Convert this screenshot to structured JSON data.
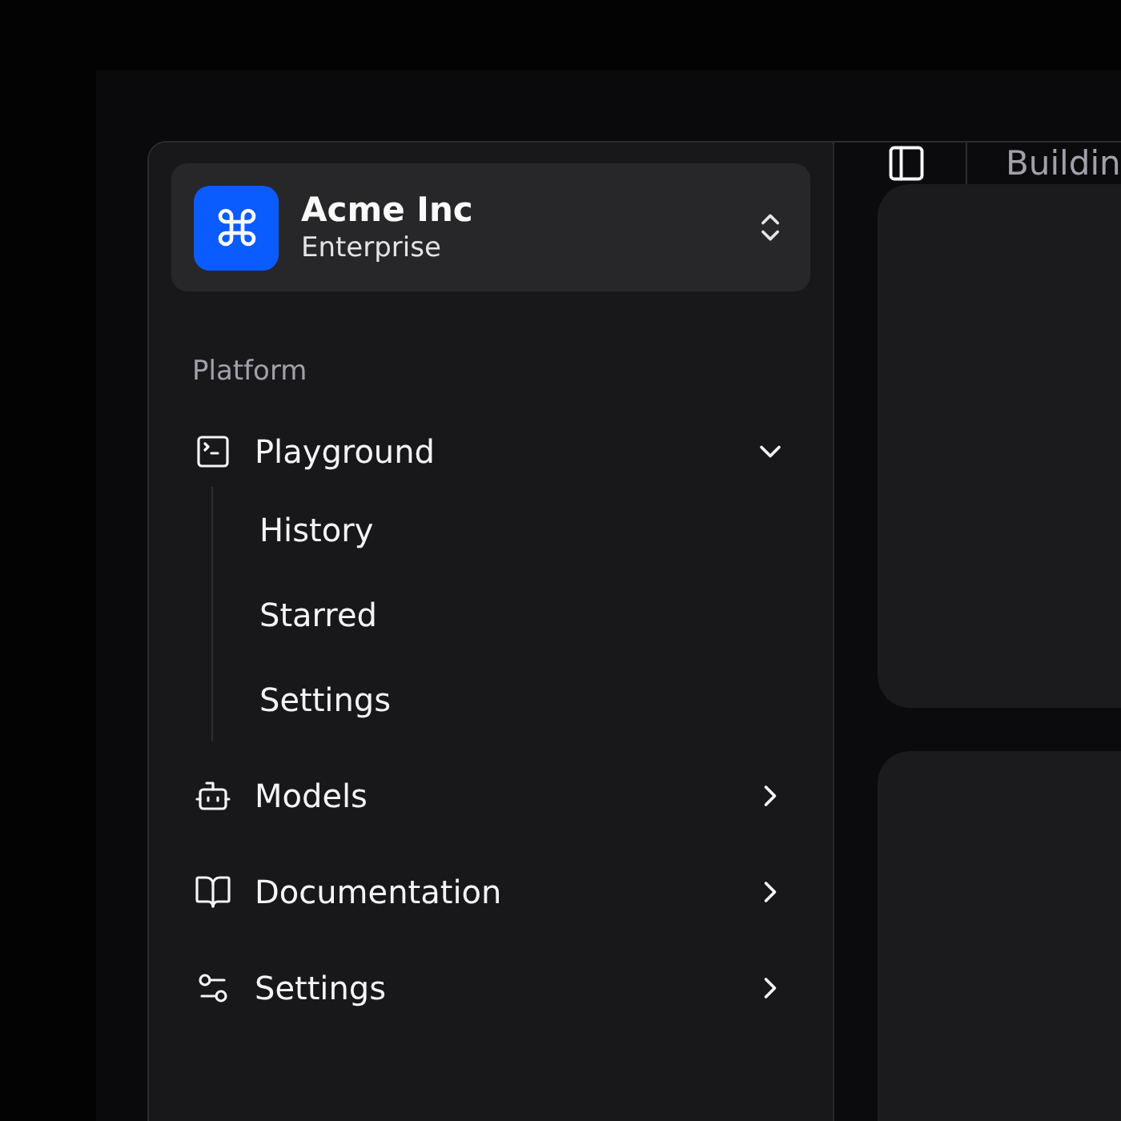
{
  "team": {
    "name": "Acme Inc",
    "plan": "Enterprise"
  },
  "nav": {
    "group_label": "Platform",
    "items": [
      {
        "kind": "terminal",
        "label": "Playground",
        "expanded": true,
        "children": [
          {
            "label": "History"
          },
          {
            "label": "Starred"
          },
          {
            "label": "Settings"
          }
        ]
      },
      {
        "kind": "bot",
        "label": "Models",
        "expanded": false
      },
      {
        "kind": "book",
        "label": "Documentation",
        "expanded": false
      },
      {
        "kind": "sliders",
        "label": "Settings",
        "expanded": false
      }
    ]
  },
  "header": {
    "breadcrumb": "Buildin"
  }
}
